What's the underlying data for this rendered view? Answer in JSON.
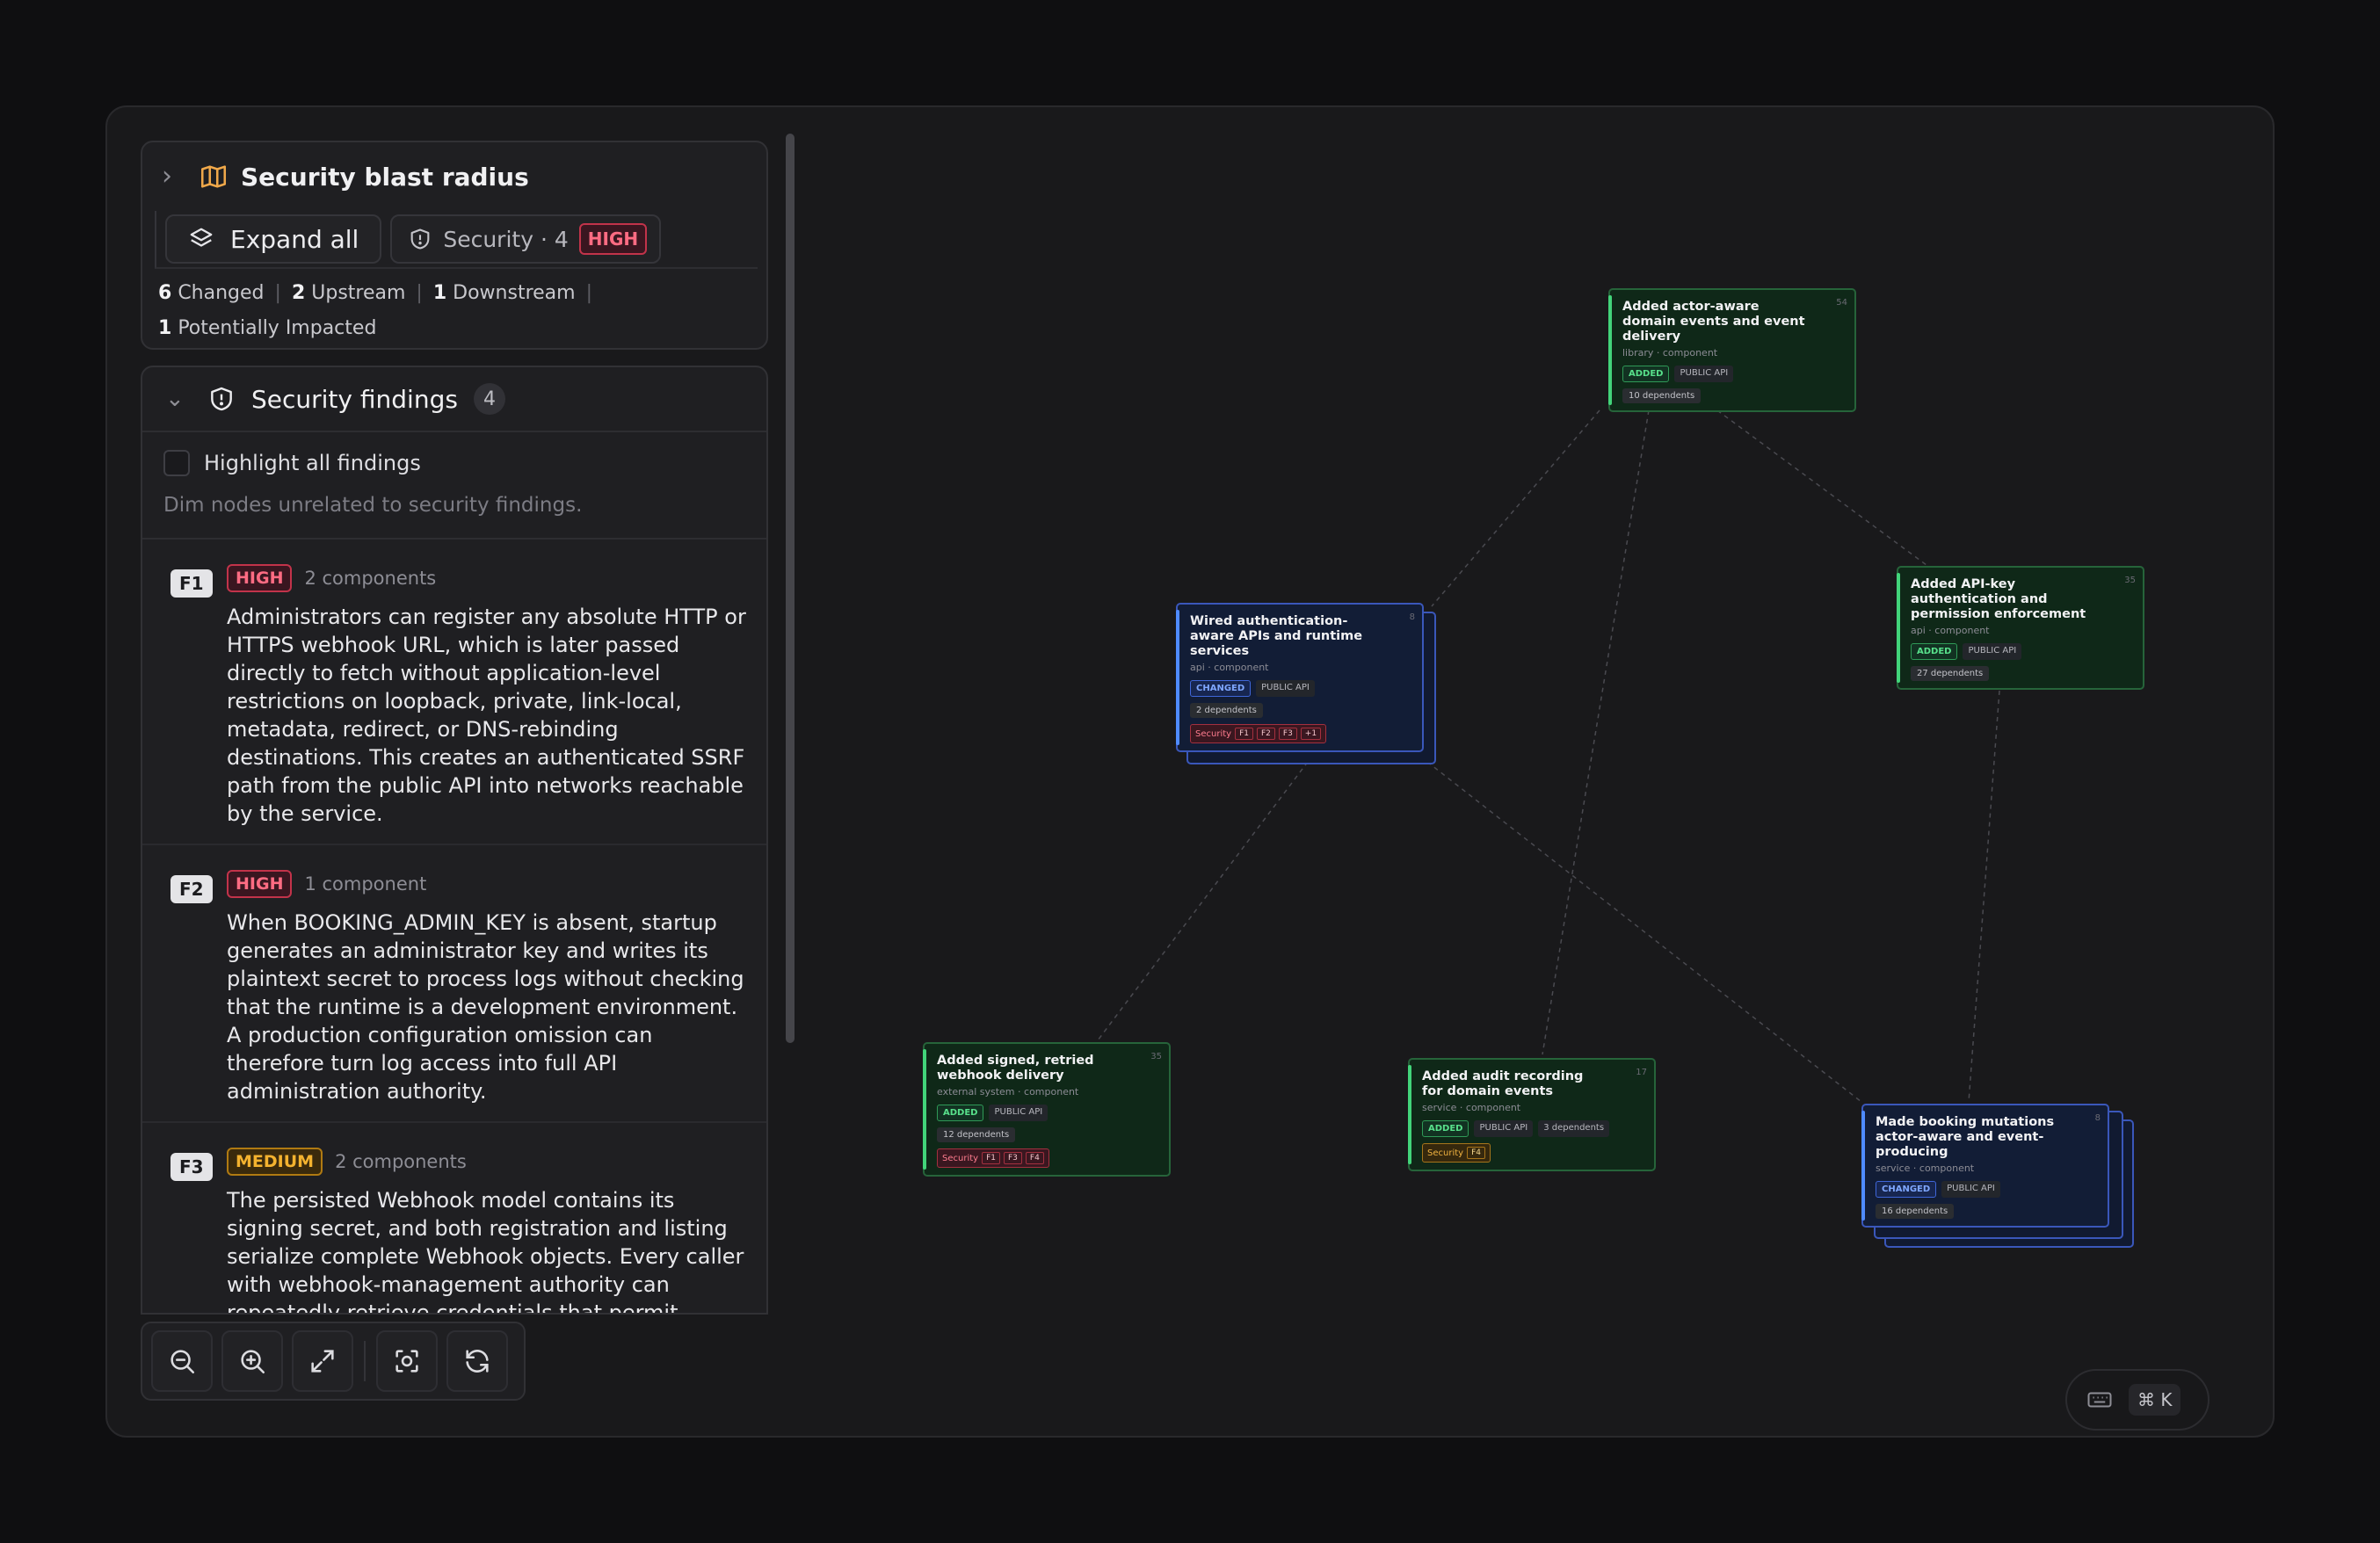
{
  "blast": {
    "title": "Security blast radius",
    "expand_label": "Expand all",
    "security_label": "Security · 4",
    "security_badge": "HIGH",
    "stats": {
      "changed_n": "6",
      "changed_label": "Changed",
      "upstream_n": "2",
      "upstream_label": "Upstream",
      "downstream_n": "1",
      "downstream_label": "Downstream",
      "impacted_n": "1",
      "impacted_label": "Potentially Impacted"
    }
  },
  "findings": {
    "title": "Security findings",
    "count": "4",
    "highlight_label": "Highlight all findings",
    "dim_note": "Dim nodes unrelated to security findings.",
    "items": [
      {
        "id": "F1",
        "severity": "HIGH",
        "components": "2 components",
        "text": "Administrators can register any absolute HTTP or HTTPS webhook URL, which is later passed directly to fetch without application-level restrictions on loopback, private, link-local, metadata, redirect, or DNS-rebinding destinations. This creates an authenticated SSRF path from the public API into networks reachable by the service."
      },
      {
        "id": "F2",
        "severity": "HIGH",
        "components": "1 component",
        "text": "When BOOKING_ADMIN_KEY is absent, startup generates an administrator key and writes its plaintext secret to process logs without checking that the runtime is a development environment. A production configuration omission can therefore turn log access into full API administration authority."
      },
      {
        "id": "F3",
        "severity": "MEDIUM",
        "components": "2 components",
        "text": "The persisted Webhook model contains its signing secret, and both registration and listing serialize complete Webhook objects. Every caller with webhook-management authority can repeatedly retrieve credentials that permit forging apparently authentic webhook messages."
      }
    ]
  },
  "zoom_controls": [
    "zoom-out-icon",
    "zoom-in-icon",
    "fit-view-icon",
    "focus-icon",
    "refresh-icon"
  ],
  "graph": {
    "nodes": {
      "domain_events": {
        "title": "Added actor-aware domain events and event delivery",
        "sub": "library · component",
        "status": "ADDED",
        "api": "PUBLIC API",
        "deps": "10 dependents",
        "code": "54"
      },
      "auth_apis": {
        "title": "Wired authentication-aware APIs and runtime services",
        "sub": "api · component",
        "status": "CHANGED",
        "api": "PUBLIC API",
        "deps": "2 dependents",
        "code": "8",
        "security": "Security",
        "chips": [
          "F1",
          "F2",
          "F3",
          "+1"
        ]
      },
      "apikey": {
        "title": "Added API-key authentication and permission enforcement",
        "sub": "api · component",
        "status": "ADDED",
        "api": "PUBLIC API",
        "deps": "27 dependents",
        "code": "35"
      },
      "webhook": {
        "title": "Added signed, retried webhook delivery",
        "sub": "external system · component",
        "status": "ADDED",
        "api": "PUBLIC API",
        "deps": "12 dependents",
        "code": "35",
        "security": "Security",
        "chips": [
          "F1",
          "F3",
          "F4"
        ]
      },
      "audit": {
        "title": "Added audit recording for domain events",
        "sub": "service · component",
        "status": "ADDED",
        "api": "PUBLIC API",
        "deps": "3 dependents",
        "code": "17",
        "security": "Security",
        "chips": [
          "F4"
        ]
      },
      "booking": {
        "title": "Made booking mutations actor-aware and event-producing",
        "sub": "service · component",
        "status": "CHANGED",
        "api": "PUBLIC API",
        "deps": "16 dependents",
        "code": "8"
      }
    }
  },
  "shortcut": {
    "key": "⌘ K"
  },
  "colors": {
    "added": "#42d47a",
    "changed": "#4f8bff",
    "high": "#ff6c83",
    "medium": "#f3b22f",
    "brand_icon": "#f0a84a"
  }
}
